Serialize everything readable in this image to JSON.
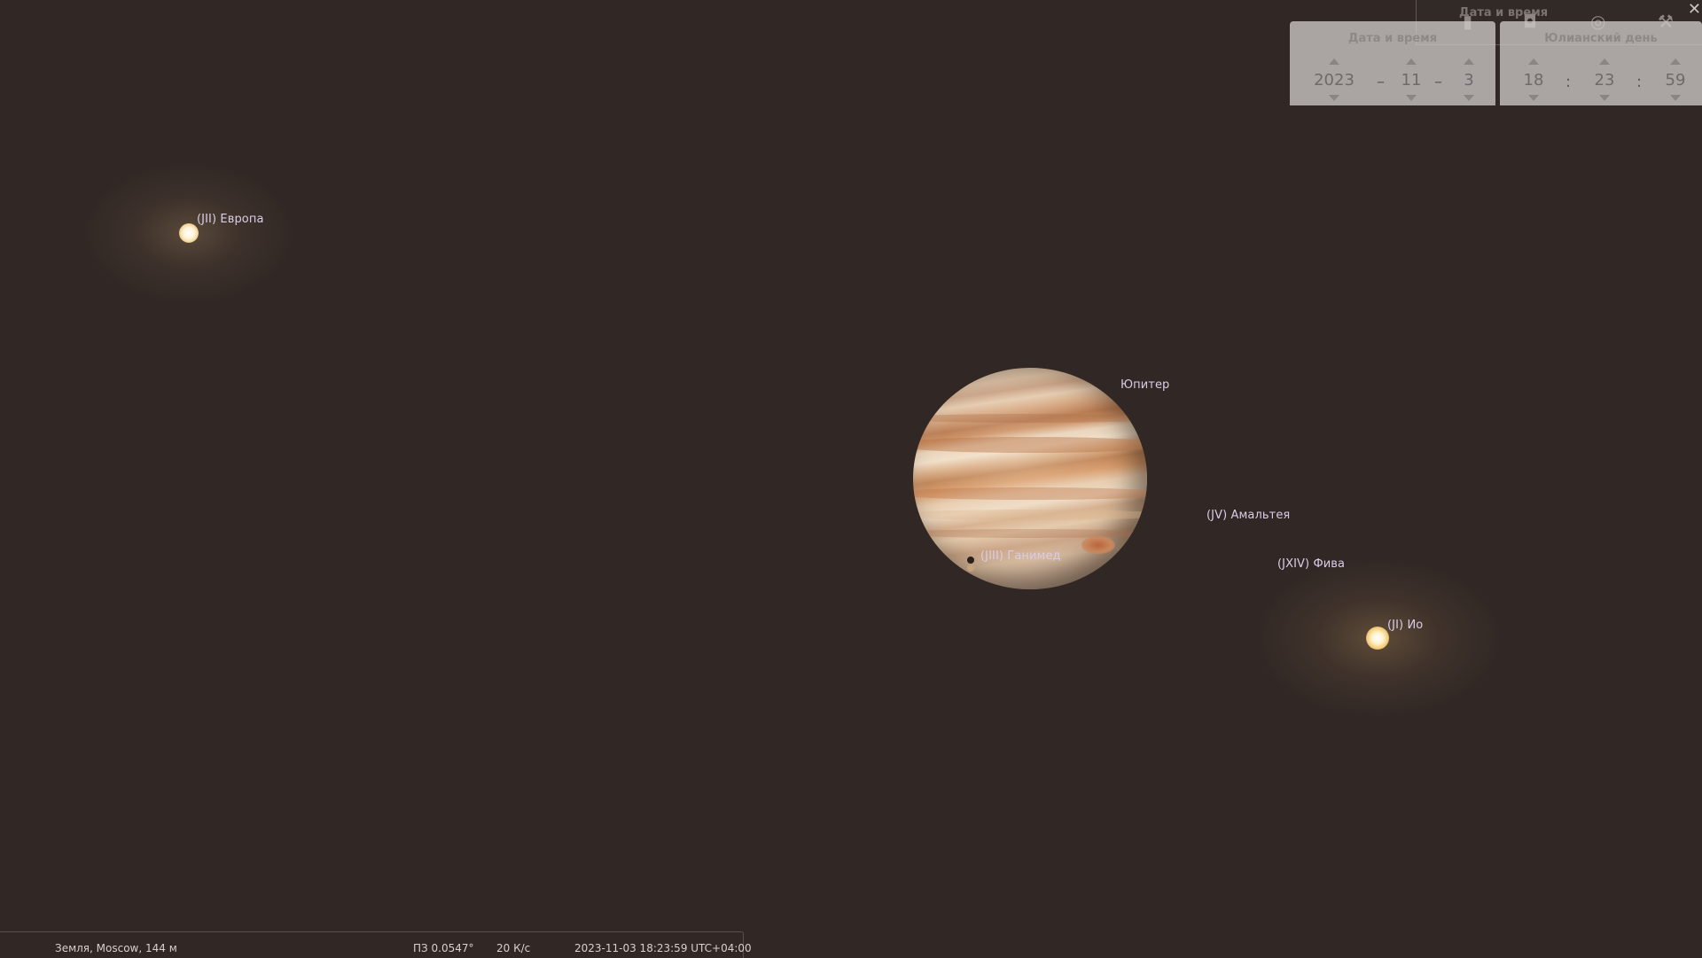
{
  "sky": {
    "objects": {
      "europa": {
        "label": "(JII) Европа"
      },
      "jupiter": {
        "label": "Юпитер"
      },
      "amalthea": {
        "label": "(JV) Амальтея"
      },
      "ganymede": {
        "label": "(JIII) Ганимед"
      },
      "thebe": {
        "label": "(JXIV) Фива"
      },
      "io": {
        "label": "(JI) Ио"
      }
    }
  },
  "toolbar": {
    "title": "Дата и время",
    "close_glyph": "✕",
    "icons": [
      "mouse-icon",
      "screen-icon",
      "target-icon",
      "wrench-icon"
    ]
  },
  "datetime_panel": {
    "date_title": "Дата и время",
    "jd_title": "Юлианский день",
    "year": "2023",
    "month": "11",
    "day": "3",
    "hour": "18",
    "minute": "23",
    "second": "59",
    "date_sep": "–",
    "time_sep": ":"
  },
  "status": {
    "location": "Земля, Moscow, 144 м",
    "fov": "ПЗ 0.0547°",
    "fps": "20 К/с",
    "datetime": "2023-11-03 18:23:59 UTC+04:00"
  },
  "colors": {
    "background": "#312825",
    "label": "#d9cde6",
    "panel": "#cdc8c6"
  }
}
